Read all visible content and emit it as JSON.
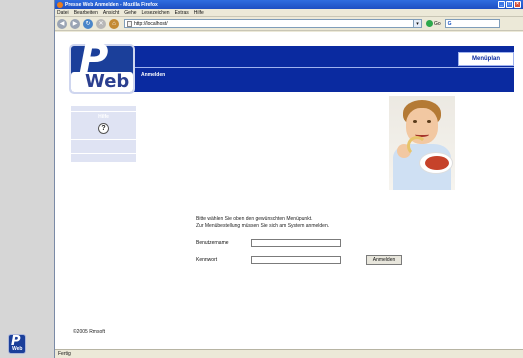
{
  "window": {
    "title": "Presse Web Anmelden - Mozilla Firefox",
    "min": "_",
    "max": "□",
    "close": "×"
  },
  "menubar": [
    "Datei",
    "Bearbeiten",
    "Ansicht",
    "Gehe",
    "Lesezeichen",
    "Extras",
    "Hilfe"
  ],
  "navbar": {
    "url": "http://localhost/",
    "go_label": "Go",
    "search_placeholder": "G",
    "dropdown": "▾"
  },
  "page": {
    "logo_text": "Web",
    "logo_letter": "P",
    "menu_tab": "Menüplan",
    "heading": "Anmelden",
    "sidebar_label": "Hilfe",
    "help_glyph": "?",
    "intro_line1": "Bitte wählen Sie oben den gewünschten Menüpunkt.",
    "intro_line2": "Zur Menübestellung müssen Sie sich am System anmelden.",
    "username_label": "Benutzername",
    "password_label": "Kennwort",
    "login_button": "Anmelden",
    "copyright": "©2005 Rmsoft"
  },
  "desktop": {
    "logo_letter": "P",
    "logo_text": "Web"
  },
  "status": {
    "text": "Fertig"
  }
}
